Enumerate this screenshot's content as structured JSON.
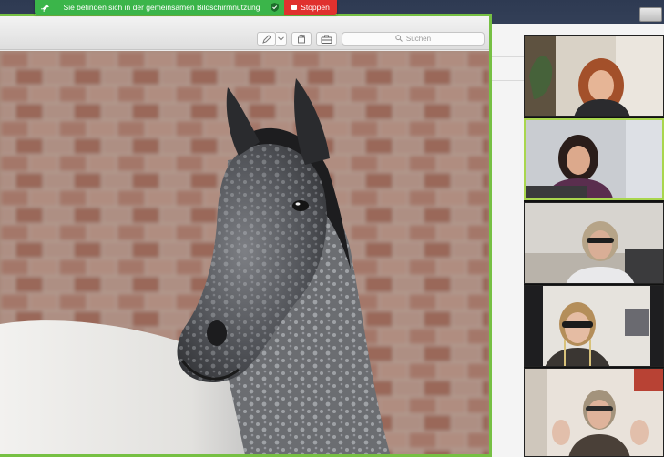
{
  "share_banner": {
    "status_text": "Sie befinden sich in der gemeinsamen Bildschirmnutzung",
    "stop_label": "Stoppen",
    "status_color": "#3bb54a",
    "stop_color": "#e0312e"
  },
  "window": {
    "border_color": "#76c043",
    "toolbar_icons": [
      "pen-icon",
      "chevron-down-icon",
      "rotate-icon",
      "toolbox-icon"
    ],
    "search": {
      "placeholder": "Suchen",
      "icon": "search-icon"
    }
  },
  "gallery": {
    "active_color": "#a9d64e",
    "participants": [
      {
        "tile": "participant-video-1",
        "active": false
      },
      {
        "tile": "participant-video-2",
        "active": true
      },
      {
        "tile": "participant-video-3",
        "active": false
      },
      {
        "tile": "participant-video-4",
        "active": false
      },
      {
        "tile": "participant-video-5",
        "active": false
      }
    ]
  }
}
